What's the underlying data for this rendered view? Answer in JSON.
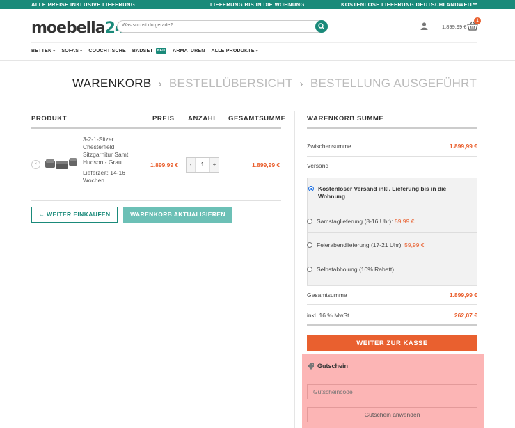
{
  "topbar": {
    "left": "ALLE PREISE INKLUSIVE LIEFERUNG",
    "center": "LIEFERUNG BIS IN DIE WOHNUNG",
    "right": "KOSTENLOSE LIEFERUNG DEUTSCHLANDWEIT**"
  },
  "logo": {
    "word": "moebella",
    "num": "24"
  },
  "search": {
    "placeholder": "Was suchst du gerade?"
  },
  "header": {
    "cart_total": "1.899,99 €",
    "cart_count": "1"
  },
  "nav": {
    "items": [
      "BETTEN",
      "SOFAS",
      "COUCHTISCHE",
      "BADSET",
      "ARMATUREN",
      "ALLE PRODUKTE"
    ],
    "badge": "NEU"
  },
  "steps": [
    "WARENKORB",
    "BESTELLÜBERSICHT",
    "BESTELLUNG AUSGEFÜHRT"
  ],
  "cart": {
    "headers": {
      "product": "PRODUKT",
      "price": "PREIS",
      "qty": "ANZAHL",
      "total": "GESAMTSUMME"
    },
    "item": {
      "name": "3-2-1-Sitzer Chesterfield Sitzgarnitur Samt Hudson - Grau",
      "delivery": "Lieferzeit: 14-16 Wochen",
      "price": "1.899,99 €",
      "qty": "1",
      "total": "1.899,99 €",
      "minus": "-",
      "plus": "+",
      "remove": "×"
    },
    "continue_btn": "← WEITER EINKAUFEN",
    "update_btn": "WARENKORB AKTUALISIEREN"
  },
  "summary": {
    "title": "WARENKORB SUMME",
    "subtotal_label": "Zwischensumme",
    "subtotal_value": "1.899,99 €",
    "shipping_label": "Versand",
    "shipping_options": [
      {
        "label": "Kostenloser Versand inkl. Lieferung bis in die Wohnung",
        "price": ""
      },
      {
        "label": "Samstaglieferung (8-16 Uhr): ",
        "price": "59,99 €"
      },
      {
        "label": "Feierabendlieferung (17-21 Uhr): ",
        "price": "59,99 €"
      },
      {
        "label": "Selbstabholung (10% Rabatt)",
        "price": ""
      }
    ],
    "total_label": "Gesamtsumme",
    "total_value": "1.899,99 €",
    "tax_label": "inkl. 16 % MwSt.",
    "tax_value": "262,07 €",
    "checkout_btn": "WEITER ZUR KASSE"
  },
  "coupon": {
    "title": "Gutschein",
    "placeholder": "Gutscheincode",
    "apply_btn": "Gutschein anwenden"
  },
  "colors": {
    "brand": "#1a8a7a",
    "accent": "#e9602f",
    "highlight": "#fcb5b5"
  }
}
